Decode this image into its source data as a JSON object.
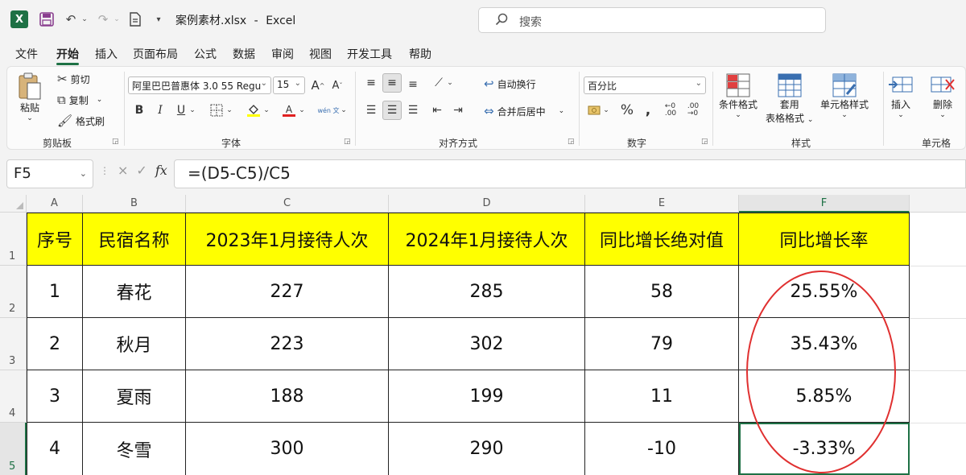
{
  "titlebar": {
    "app_logo": "X",
    "file_name": "案例素材.xlsx",
    "separator": "-",
    "app_name": "Excel",
    "search_placeholder": "搜索",
    "icons": [
      "excel-logo-icon",
      "save-icon",
      "undo-icon",
      "redo-icon",
      "sheet-icon",
      "search-icon"
    ]
  },
  "menu": {
    "tabs": [
      "文件",
      "开始",
      "插入",
      "页面布局",
      "公式",
      "数据",
      "审阅",
      "视图",
      "开发工具",
      "帮助"
    ],
    "active_index": 1
  },
  "ribbon": {
    "clipboard": {
      "paste": "粘贴",
      "cut": "剪切",
      "copy": "复制",
      "format_painter": "格式刷",
      "label": "剪贴板"
    },
    "font": {
      "font_name": "阿里巴巴普惠体 3.0 55 Regu",
      "font_size": "15",
      "grow": "A",
      "shrink": "A",
      "bold": "B",
      "italic": "I",
      "underline": "U",
      "phonetic": "wén 文",
      "fill_color": "#ffff00",
      "font_color": "#e02020",
      "label": "字体"
    },
    "alignment": {
      "wrap_text": "自动换行",
      "merge_center": "合并后居中",
      "label": "对齐方式"
    },
    "number": {
      "format": "百分比",
      "label": "数字"
    },
    "styles": {
      "conditional_format": "条件格式",
      "table_format_line1": "套用",
      "table_format_line2": "表格格式",
      "cell_styles": "单元格样式",
      "label": "样式"
    },
    "cells": {
      "insert": "插入",
      "delete": "删除",
      "label": "单元格"
    }
  },
  "formula_bar": {
    "name_box": "F5",
    "cancel": "×",
    "enter": "✓",
    "fx": "fx",
    "formula": "=(D5-C5)/C5"
  },
  "grid": {
    "column_headers": [
      "A",
      "B",
      "C",
      "D",
      "E",
      "F"
    ],
    "row_headers": [
      "1",
      "2",
      "3",
      "4",
      "5"
    ],
    "selected_cell": "F5",
    "header_fill": "#ffff00",
    "rows": [
      [
        "序号",
        "民宿名称",
        "2023年1月接待人次",
        "2024年1月接待人次",
        "同比增长绝对值",
        "同比增长率"
      ],
      [
        "1",
        "春花",
        "227",
        "285",
        "58",
        "25.55%"
      ],
      [
        "2",
        "秋月",
        "223",
        "302",
        "79",
        "35.43%"
      ],
      [
        "3",
        "夏雨",
        "188",
        "199",
        "11",
        "5.85%"
      ],
      [
        "4",
        "冬雪",
        "300",
        "290",
        "-10",
        "-3.33%"
      ]
    ],
    "annotation_color": "#e03030"
  }
}
